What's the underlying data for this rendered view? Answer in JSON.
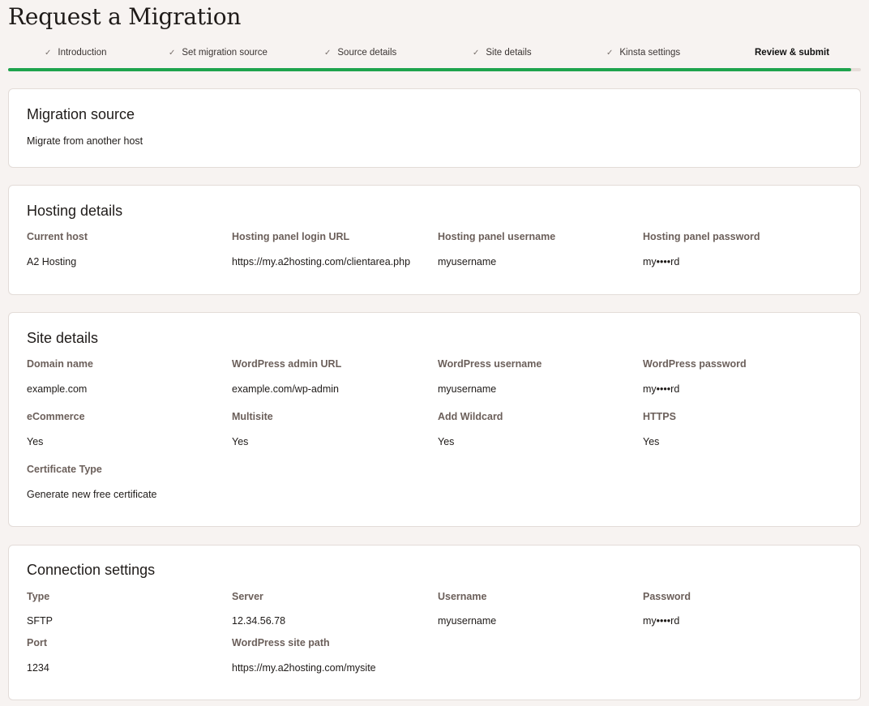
{
  "page": {
    "title": "Request a Migration"
  },
  "steps": [
    {
      "label": "Introduction",
      "done": true
    },
    {
      "label": "Set migration source",
      "done": true
    },
    {
      "label": "Source details",
      "done": true
    },
    {
      "label": "Site details",
      "done": true
    },
    {
      "label": "Kinsta settings",
      "done": true
    },
    {
      "label": "Review & submit",
      "done": false,
      "current": true
    }
  ],
  "progress": {
    "percent": 98.9,
    "color": "#1ea34d"
  },
  "migration_source": {
    "title": "Migration source",
    "value": "Migrate from another host"
  },
  "hosting_details": {
    "title": "Hosting details",
    "fields": [
      {
        "label": "Current host",
        "value": "A2 Hosting"
      },
      {
        "label": "Hosting panel login URL",
        "value": "https://my.a2hosting.com/clientarea.php"
      },
      {
        "label": "Hosting panel username",
        "value": "myusername"
      },
      {
        "label": "Hosting panel password",
        "value": "my••••rd"
      }
    ]
  },
  "site_details": {
    "title": "Site details",
    "fields": [
      {
        "label": "Domain name",
        "value": "example.com"
      },
      {
        "label": "WordPress admin URL",
        "value": "example.com/wp-admin"
      },
      {
        "label": "WordPress username",
        "value": "myusername"
      },
      {
        "label": "WordPress password",
        "value": "my••••rd"
      },
      {
        "label": "eCommerce",
        "value": "Yes"
      },
      {
        "label": "Multisite",
        "value": "Yes"
      },
      {
        "label": "Add Wildcard",
        "value": "Yes"
      },
      {
        "label": "HTTPS",
        "value": "Yes"
      },
      {
        "label": "Certificate Type",
        "value": "Generate new free certificate"
      }
    ]
  },
  "connection_settings": {
    "title": "Connection settings",
    "fields": [
      {
        "label": "Type",
        "value": "SFTP"
      },
      {
        "label": "Server",
        "value": "12.34.56.78"
      },
      {
        "label": "Username",
        "value": "myusername"
      },
      {
        "label": "Password",
        "value": "my••••rd"
      },
      {
        "label": "Port",
        "value": "1234"
      },
      {
        "label": "WordPress site path",
        "value": "https://my.a2hosting.com/mysite"
      }
    ]
  }
}
